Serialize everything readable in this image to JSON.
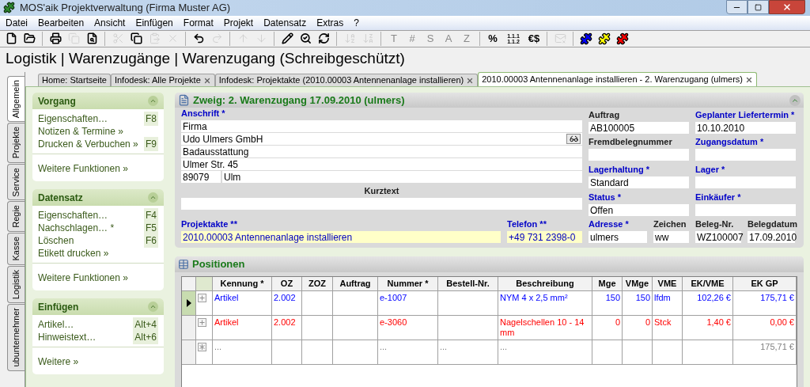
{
  "window": {
    "title": "MOS'aik Projektverwaltung (Firma Muster AG)"
  },
  "menu": [
    "Datei",
    "Bearbeiten",
    "Ansicht",
    "Einfügen",
    "Format",
    "Projekt",
    "Datensatz",
    "Extras",
    "?"
  ],
  "toolbar": [
    {
      "kind": "icon",
      "disabled": false
    },
    {
      "kind": "icon",
      "disabled": false
    },
    {
      "kind": "separator"
    },
    {
      "kind": "icon",
      "disabled": false
    },
    {
      "kind": "icon",
      "disabled": true
    },
    {
      "kind": "icon",
      "disabled": false
    },
    {
      "kind": "separator"
    },
    {
      "kind": "icon",
      "disabled": true
    },
    {
      "kind": "icon",
      "disabled": false
    },
    {
      "kind": "icon",
      "disabled": true
    },
    {
      "kind": "icon",
      "disabled": true
    },
    {
      "kind": "separator"
    },
    {
      "kind": "icon",
      "disabled": false
    },
    {
      "kind": "icon",
      "disabled": true
    },
    {
      "kind": "separator"
    },
    {
      "kind": "icon",
      "disabled": true
    },
    {
      "kind": "icon",
      "disabled": true
    },
    {
      "kind": "separator"
    },
    {
      "kind": "icon",
      "disabled": false
    },
    {
      "kind": "icon",
      "disabled": false
    },
    {
      "kind": "icon",
      "disabled": false
    },
    {
      "kind": "separator"
    },
    {
      "kind": "icon",
      "disabled": true
    },
    {
      "kind": "icon",
      "disabled": true
    },
    {
      "kind": "separator"
    },
    {
      "kind": "glyph",
      "label": "T",
      "disabled": true
    },
    {
      "kind": "glyph",
      "label": "#",
      "disabled": true
    },
    {
      "kind": "glyph",
      "label": "S",
      "disabled": true
    },
    {
      "kind": "glyph",
      "label": "A",
      "disabled": true
    },
    {
      "kind": "glyph",
      "label": "Z",
      "disabled": true
    },
    {
      "kind": "separator"
    },
    {
      "kind": "glyph",
      "label": "%",
      "disabled": false
    },
    {
      "kind": "glyph",
      "label": "1.1.1 1.1.2",
      "disabled": false
    },
    {
      "kind": "glyph",
      "label": "€$",
      "disabled": false
    },
    {
      "kind": "separator"
    },
    {
      "kind": "icon",
      "disabled": true
    },
    {
      "kind": "separator"
    },
    {
      "kind": "puzzle",
      "color": "#0000ff"
    },
    {
      "kind": "puzzle",
      "color": "#ffff00"
    },
    {
      "kind": "puzzle",
      "color": "#ff0000"
    }
  ],
  "heading": "Logistik | Warenzugänge | Warenzugang (Schreibgeschützt)",
  "side_tabs": [
    {
      "label": "Allgemein",
      "selected": true
    },
    {
      "label": "Projekte",
      "selected": false
    },
    {
      "label": "Service",
      "selected": false
    },
    {
      "label": "Regie",
      "selected": false
    },
    {
      "label": "Kasse",
      "selected": false
    },
    {
      "label": "Logistik",
      "selected": false
    },
    {
      "label": "ubunternehmer",
      "selected": false
    }
  ],
  "tabs": [
    {
      "label": "Home: Startseite",
      "selected": false,
      "closable": false
    },
    {
      "label": "Infodesk: Alle Projekte",
      "selected": false,
      "closable": true
    },
    {
      "label": "Infodesk: Projektakte (2010.00003 Antennenanlage installieren)",
      "selected": false,
      "closable": true
    },
    {
      "label": "2010.00003 Antennenanlage installieren - 2. Warenzugang (ulmers)",
      "selected": true,
      "closable": true
    }
  ],
  "side_panels": [
    {
      "title": "Vorgang",
      "expanded": true,
      "items": [
        {
          "label": "Eigenschaften…",
          "shortcut": "F8"
        },
        {
          "label": "Notizen & Termine »"
        },
        {
          "label": "Drucken & Verbuchen »",
          "shortcut": "F9"
        }
      ],
      "more": "Weitere Funktionen »"
    },
    {
      "title": "Datensatz",
      "expanded": true,
      "items": [
        {
          "label": "Eigenschaften…",
          "shortcut": "F4"
        },
        {
          "label": "Nachschlagen… *",
          "shortcut": "F5"
        },
        {
          "label": "Löschen",
          "shortcut": "F6"
        },
        {
          "label": "Etikett drucken »"
        }
      ],
      "more": "Weitere Funktionen »"
    },
    {
      "title": "Einfügen",
      "expanded": true,
      "items": [
        {
          "label": "Artikel…",
          "shortcut": "Alt+4"
        },
        {
          "label": "Hinweistext…",
          "shortcut": "Alt+6"
        }
      ],
      "more": "Weitere »"
    }
  ],
  "form": {
    "title": "Zweig: 2. Warenzugang 17.09.2010 (ulmers)",
    "expanded": true,
    "address": {
      "label": "Anschrift *",
      "required": true,
      "lines": [
        "Firma",
        "Udo Ulmers GmbH",
        "Badausstattung",
        "Ulmer Str. 45"
      ],
      "zip": "89079",
      "city": "Ulm"
    },
    "kurztext": {
      "label": "Kurztext",
      "required": false
    },
    "columns": [
      [
        {
          "label": "Auftrag",
          "required": false,
          "value": "AB100005"
        },
        {
          "label": "Fremdbelegnummer",
          "required": false
        },
        {
          "label": "Lagerhaltung *",
          "required": true,
          "value": "Standard"
        },
        {
          "label": "Status *",
          "required": true,
          "value": "Offen"
        }
      ],
      [
        {
          "label": "Geplanter Liefertermin *",
          "required": true,
          "value": "10.10.2010"
        },
        {
          "label": "Zugangsdatum *",
          "required": true
        },
        {
          "label": "Lager *",
          "required": true
        },
        {
          "label": "Einkäufer *",
          "required": true
        }
      ]
    ],
    "bottom": [
      {
        "label": "Projektakte **",
        "required": true,
        "value": "2010.00003 Antennenanlage installieren",
        "highlighted": true
      },
      {
        "label": "Telefon **",
        "required": true,
        "value": "+49 731 2398-0",
        "highlighted": true
      },
      {
        "label": "Adresse *",
        "required": true,
        "value": "ulmers",
        "highlighted": false
      },
      {
        "label": "Zeichen",
        "required": false,
        "value": "ww",
        "highlighted": false
      },
      {
        "label": "Beleg-Nr.",
        "required": false,
        "value": "WZ100007",
        "highlighted": false
      },
      {
        "label": "Belegdatum",
        "required": false,
        "value": "17.09.2010",
        "highlighted": false
      }
    ]
  },
  "positions": {
    "title": "Positionen",
    "columns": [
      {
        "label": "Kennung *",
        "kind": "text"
      },
      {
        "label": "OZ",
        "kind": "text"
      },
      {
        "label": "ZOZ",
        "kind": "text"
      },
      {
        "label": "Auftrag",
        "kind": "text"
      },
      {
        "label": "Nummer *",
        "kind": "text"
      },
      {
        "label": "Bestell-Nr.",
        "kind": "text"
      },
      {
        "label": "Beschreibung",
        "kind": "text"
      },
      {
        "label": "Mge",
        "kind": "number"
      },
      {
        "label": "VMge",
        "kind": "number"
      },
      {
        "label": "VME",
        "kind": "text"
      },
      {
        "label": "EK/VME",
        "kind": "number"
      },
      {
        "label": "EK GP",
        "kind": "number"
      }
    ],
    "rows": [
      {
        "kind": "item",
        "selected": true,
        "color": "#0000ff",
        "cells": [
          "Artikel",
          "2.002",
          "",
          "",
          "e-1007",
          "",
          "NYM 4 x 2,5 mm²",
          "150",
          "150",
          "lfdm",
          "102,26 €",
          "175,71 €"
        ]
      },
      {
        "kind": "item",
        "selected": false,
        "color": "#ff0000",
        "cells": [
          "Artikel",
          "2.002",
          "",
          "",
          "e-3060",
          "",
          "Nagelschellen 10 - 14 mm",
          "0",
          "0",
          "Stck",
          "1,40 €",
          "0,00 €"
        ]
      },
      {
        "kind": "new",
        "selected": false,
        "color": "#808080",
        "cells": [
          "...",
          "",
          "",
          "",
          "...",
          "...",
          "...",
          "",
          "",
          "",
          "",
          "175,71 €"
        ]
      }
    ]
  }
}
